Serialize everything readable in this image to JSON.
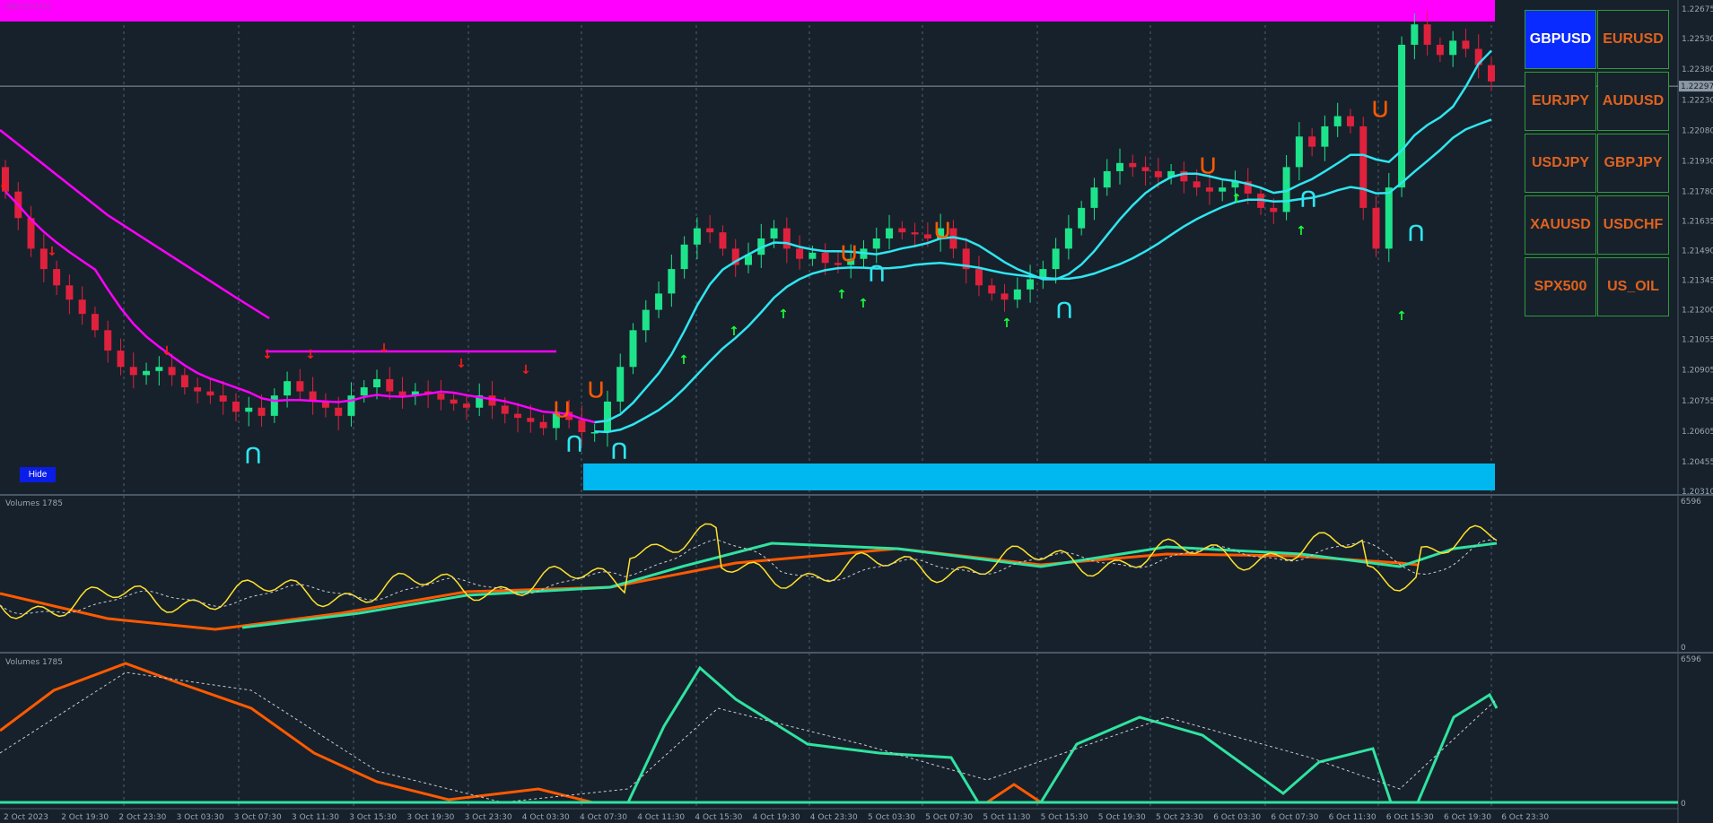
{
  "window": {
    "symbol_caption": "GBPUSD,M30"
  },
  "colors": {
    "background": "#17212b",
    "bull_candle": "#1de38a",
    "bear_candle": "#e0213d",
    "magenta": "#ff00ff",
    "cyan_line": "#2ee6f0",
    "orange": "#ff5a00",
    "yellow": "#ffe22a",
    "aqua_green": "#2fe3a0",
    "sky_box": "#00b8f0"
  },
  "hide_button": {
    "label": "Hide"
  },
  "symbol_buttons": [
    {
      "label": "GBPUSD",
      "active": true
    },
    {
      "label": "EURUSD",
      "active": false
    },
    {
      "label": "EURJPY",
      "active": false
    },
    {
      "label": "AUDUSD",
      "active": false
    },
    {
      "label": "USDJPY",
      "active": false
    },
    {
      "label": "GBPJPY",
      "active": false
    },
    {
      "label": "XAUUSD",
      "active": false
    },
    {
      "label": "USDCHF",
      "active": false
    },
    {
      "label": "SPX500",
      "active": false
    },
    {
      "label": "US_OIL",
      "active": false
    }
  ],
  "price_axis": {
    "labels": [
      "1.22675",
      "1.22530",
      "1.22380",
      "1.22297",
      "1.22230",
      "1.22080",
      "1.21930",
      "1.21780",
      "1.21635",
      "1.21490",
      "1.21345",
      "1.21200",
      "1.21055",
      "1.20905",
      "1.20755",
      "1.20605",
      "1.20455",
      "1.20310"
    ],
    "current_price": "1.22297"
  },
  "time_axis": {
    "labels": [
      "2 Oct 2023",
      "2 Oct 19:30",
      "2 Oct 23:30",
      "3 Oct 03:30",
      "3 Oct 07:30",
      "3 Oct 11:30",
      "3 Oct 15:30",
      "3 Oct 19:30",
      "3 Oct 23:30",
      "4 Oct 03:30",
      "4 Oct 07:30",
      "4 Oct 11:30",
      "4 Oct 15:30",
      "4 Oct 19:30",
      "4 Oct 23:30",
      "5 Oct 03:30",
      "5 Oct 07:30",
      "5 Oct 11:30",
      "5 Oct 15:30",
      "5 Oct 19:30",
      "5 Oct 23:30",
      "6 Oct 03:30",
      "6 Oct 07:30",
      "6 Oct 11:30",
      "6 Oct 15:30",
      "6 Oct 19:30",
      "6 Oct 23:30"
    ]
  },
  "subwindows": [
    {
      "title": "Volumes 1785",
      "max_label": "6596",
      "min_label": "0"
    },
    {
      "title": "Volumes 1785",
      "max_label": "6596",
      "min_label": "0"
    }
  ],
  "chart_data": {
    "type": "candlestick",
    "symbol": "GBPUSD",
    "timeframe": "M30",
    "ylim": [
      1.2031,
      1.2268
    ],
    "closes": [
      1.2178,
      1.2165,
      1.215,
      1.214,
      1.2132,
      1.2125,
      1.2118,
      1.211,
      1.21,
      1.2092,
      1.2088,
      1.209,
      1.2092,
      1.2088,
      1.2082,
      1.208,
      1.2078,
      1.2075,
      1.207,
      1.2072,
      1.2068,
      1.2078,
      1.2085,
      1.208,
      1.2075,
      1.2072,
      1.2068,
      1.2078,
      1.2082,
      1.2086,
      1.208,
      1.2078,
      1.208,
      1.2079,
      1.2076,
      1.2074,
      1.2072,
      1.2078,
      1.2073,
      1.2069,
      1.2067,
      1.2065,
      1.2062,
      1.207,
      1.2066,
      1.206,
      1.206,
      1.2075,
      1.2092,
      1.211,
      1.212,
      1.2128,
      1.214,
      1.2152,
      1.216,
      1.2158,
      1.215,
      1.2142,
      1.2147,
      1.2155,
      1.216,
      1.215,
      1.2145,
      1.2148,
      1.2143,
      1.2142,
      1.2145,
      1.215,
      1.2155,
      1.216,
      1.2158,
      1.2157,
      1.2155,
      1.216,
      1.215,
      1.214,
      1.2132,
      1.2128,
      1.2125,
      1.213,
      1.2135,
      1.214,
      1.215,
      1.216,
      1.217,
      1.218,
      1.2188,
      1.2192,
      1.219,
      1.2188,
      1.2185,
      1.2188,
      1.2183,
      1.218,
      1.2178,
      1.218,
      1.2183,
      1.2177,
      1.217,
      1.2168,
      1.219,
      1.2205,
      1.22,
      1.221,
      1.2215,
      1.221,
      1.217,
      1.215,
      1.218,
      1.225,
      1.226,
      1.225,
      1.2245,
      1.2252,
      1.2248,
      1.224,
      1.2232
    ],
    "series": [
      {
        "name": "Volumes 1785",
        "panel": 1
      },
      {
        "name": "Volumes 1785",
        "panel": 2
      }
    ]
  }
}
